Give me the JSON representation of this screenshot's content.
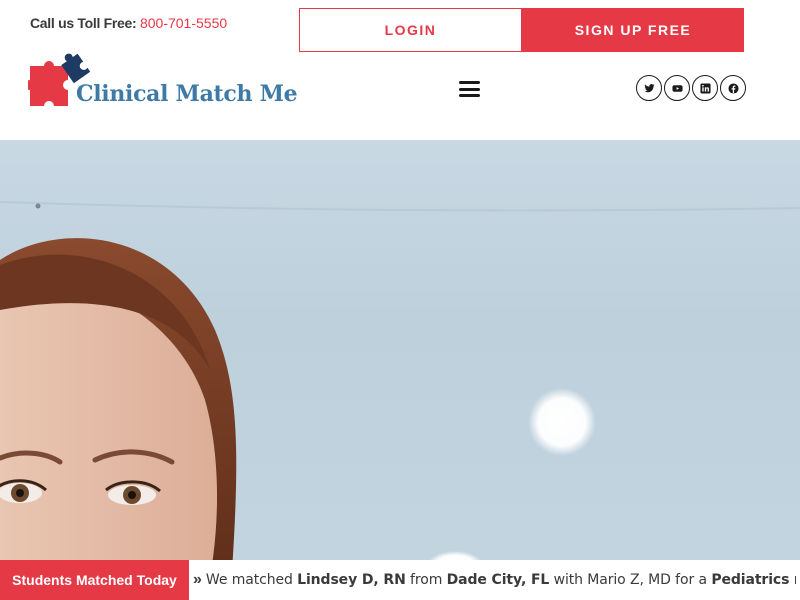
{
  "topbar": {
    "toll_label": "Call us Toll Free:",
    "toll_number": "800-701-5550",
    "login_label": "LOGIN",
    "signup_label": "SIGN UP FREE"
  },
  "brand": {
    "name": "Clinical Match Me",
    "text_color": "#3d7aa6",
    "puzzle_colors": [
      "#e63946",
      "#1f3b63"
    ]
  },
  "nav": {
    "menu_icon": "hamburger-menu-icon"
  },
  "social": [
    "twitter-icon",
    "youtube-icon",
    "linkedin-icon",
    "facebook-icon"
  ],
  "ticker": {
    "label": "Students Matched Today",
    "prefix": "We matched",
    "student": "Lindsey D, RN",
    "from_word": "from",
    "location": "Dade City, FL",
    "middle": "with Mario Z, MD for a",
    "specialty": "Pediatrics",
    "suffix": "rotation"
  },
  "colors": {
    "accent": "#e63946",
    "hero_bg": "#c4d5e0"
  }
}
